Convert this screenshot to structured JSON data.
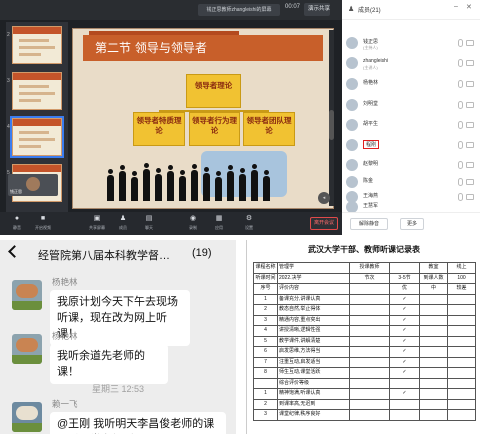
{
  "meeting": {
    "window_title": "钱正思教师zhangleishi的屏幕",
    "timer": "00:07",
    "top_button": "演示共享",
    "slide": {
      "header": "第二节 领导与领导者",
      "main_box": "领导者理论",
      "box_a": "领导者特质理论",
      "box_b": "领导者行为理论",
      "box_c": "领导者团队理论"
    },
    "thumb_numbers": [
      "2",
      "3",
      "4",
      "5"
    ],
    "camera_label": "钱正思",
    "toolbar": [
      {
        "icon": "mic-icon",
        "label": "静音"
      },
      {
        "icon": "camera-icon",
        "label": "开启视频"
      },
      {
        "icon": "share-icon",
        "label": "共享屏幕"
      },
      {
        "icon": "people-icon",
        "label": "成员"
      },
      {
        "icon": "chat-icon",
        "label": "聊天"
      },
      {
        "icon": "record-icon",
        "label": "录制"
      },
      {
        "icon": "apps-icon",
        "label": "应用"
      },
      {
        "icon": "settings-icon",
        "label": "设置"
      }
    ],
    "leave_button": "离开会议"
  },
  "participants": {
    "title": "成员(21)",
    "items": [
      {
        "name": "钱正思",
        "sub": "(主持人)"
      },
      {
        "name": "zhangleishi",
        "sub": "(主讲人)"
      },
      {
        "name": "杨艳林",
        "sub": ""
      },
      {
        "name": "刘明堂",
        "sub": ""
      },
      {
        "name": "胡平生",
        "sub": ""
      },
      {
        "name": "程刚",
        "sub": ""
      },
      {
        "name": "赵黎明",
        "sub": ""
      },
      {
        "name": "陈金",
        "sub": ""
      },
      {
        "name": "王海燕",
        "sub": ""
      },
      {
        "name": "王慧军",
        "sub": ""
      }
    ],
    "mute_all": "解除静音",
    "more": "更多"
  },
  "chat": {
    "title": "经管院第八届本科教学督…",
    "count": "(19)",
    "messages": [
      {
        "sender": "杨艳林",
        "text": "我原计划今天下午去现场听课，现在改为网上听课！"
      },
      {
        "sender": "杨艳林",
        "text": "我听余道先老师的课！"
      },
      {
        "sender": "赖一飞",
        "text": "@王刚 我听明天李昌俊老师的课程后正常参加听课"
      }
    ],
    "timestamp": "星期三 12:53"
  },
  "form": {
    "title": "武汉大学干部、教师听课记录表",
    "rows": [
      [
        "课程名称",
        "管理学",
        "授课教师",
        "",
        "教室",
        "线上"
      ],
      [
        "听课时间",
        "2022.决学",
        "节次",
        "3-5节",
        "到课人数",
        "100"
      ],
      [
        "序号",
        "评价内容",
        "",
        "优",
        "中",
        "较差"
      ],
      [
        "1",
        "备课充分,讲课认真",
        "",
        "✓",
        "",
        ""
      ],
      [
        "2",
        "教态自然,举止得体",
        "",
        "✓",
        "",
        ""
      ],
      [
        "3",
        "精通内容,重点突出",
        "",
        "✓",
        "",
        ""
      ],
      [
        "4",
        "讲授清晰,逻辑性强",
        "",
        "✓",
        "",
        ""
      ],
      [
        "5",
        "教学课件,讲解清楚",
        "",
        "✓",
        "",
        ""
      ],
      [
        "6",
        "启发思维,方法得当",
        "",
        "✓",
        "",
        ""
      ],
      [
        "7",
        "注重互动,启发适当",
        "",
        "✓",
        "",
        ""
      ],
      [
        "8",
        "师生互动,课堂活跃",
        "",
        "✓",
        "",
        ""
      ],
      [
        "",
        "综合评价等级",
        "",
        "",
        "",
        ""
      ],
      [
        "1",
        "精神饱满,听课认真",
        "",
        "✓",
        "",
        ""
      ],
      [
        "2",
        "到课率高,无迟到",
        "",
        "",
        "",
        ""
      ],
      [
        "3",
        "课堂纪律,秩序良好",
        "",
        "",
        "",
        ""
      ]
    ]
  }
}
